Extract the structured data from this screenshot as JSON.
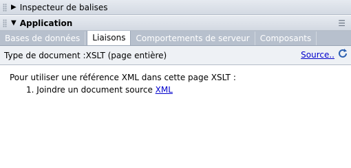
{
  "tag_inspector": {
    "label": "Inspecteur de balises"
  },
  "application": {
    "label": "Application",
    "options_icon": "panel-options-icon"
  },
  "tabs": [
    {
      "label": "Bases de données",
      "active": false
    },
    {
      "label": "Liaisons",
      "active": true
    },
    {
      "label": "Comportements de serveur",
      "active": false
    },
    {
      "label": "Composants",
      "active": false
    }
  ],
  "toolbar": {
    "doc_type": "Type de document :XSLT (page entière)",
    "source_link": "Source..",
    "refresh_icon": "refresh-icon"
  },
  "content": {
    "intro": "Pour utiliser une référence XML dans cette page XSLT :",
    "step_number": "1.",
    "step_text": "Joindre un document source",
    "step_link": "XML"
  },
  "colors": {
    "tab_bar": "#b7c0cd",
    "link": "#0000cc",
    "header": "#d3d9e2"
  }
}
